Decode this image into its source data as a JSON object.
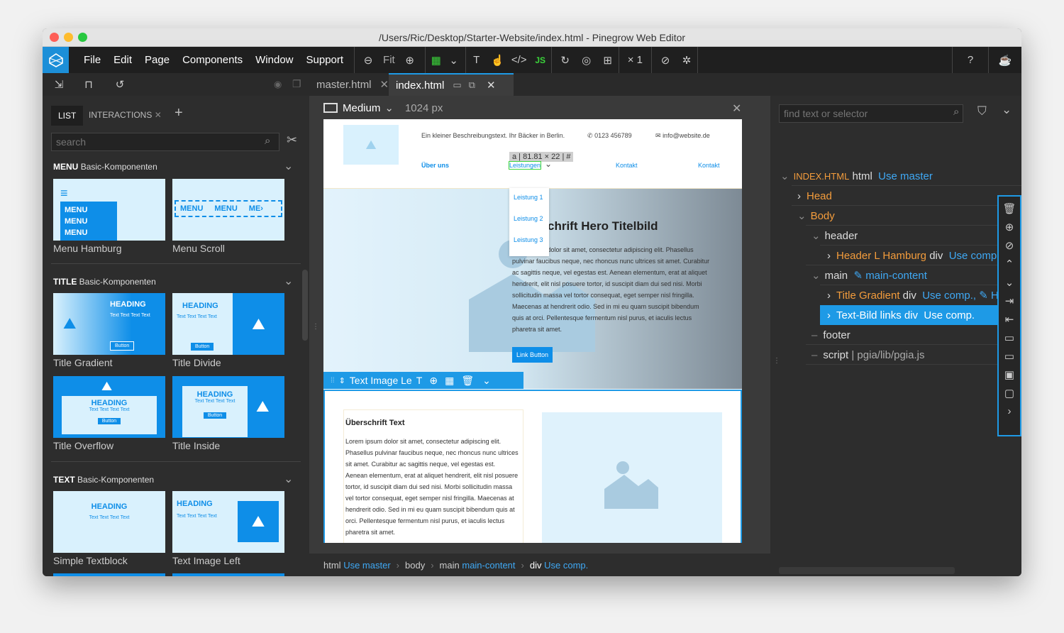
{
  "window": {
    "title": "/Users/Ric/Desktop/Starter-Website/index.html - Pinegrow Web Editor"
  },
  "menu": {
    "file": "File",
    "edit": "Edit",
    "page": "Page",
    "components": "Components",
    "window": "Window",
    "support": "Support"
  },
  "toolbar": {
    "fit": "Fit",
    "zoom": "× 1"
  },
  "tabs": [
    {
      "label": "master.html"
    },
    {
      "label": "index.html"
    }
  ],
  "library": {
    "tab_list": "LIST",
    "tab_interactions": "INTERACTIONS",
    "search_placeholder": "search",
    "sections": [
      {
        "kind": "MENU",
        "name": "Basic-Komponenten"
      },
      {
        "kind": "TITLE",
        "name": "Basic-Komponenten"
      },
      {
        "kind": "TEXT",
        "name": "Basic-Komponenten"
      }
    ],
    "items": [
      "Menu Hamburg",
      "Menu Scroll",
      "Title Gradient",
      "Title Divide",
      "Title Overflow",
      "Title Inside",
      "Simple Textblock",
      "Text Image Left"
    ],
    "thumb_text": {
      "menu": "MENU",
      "heading": "HEADING",
      "button": "Button",
      "text": "Text Text Text Text"
    }
  },
  "canvas": {
    "device": "Medium",
    "width": "1024 px",
    "header_desc": "Ein kleiner Beschreibungstext. Ihr Bäcker in Berlin.",
    "phone": "0123 456789",
    "email": "info@website.de",
    "size_tip": "a | 81.81 × 22 | #",
    "nav": [
      "Über uns",
      "Leistungen",
      "Kontakt",
      "Kontakt"
    ],
    "dropdown": [
      "Leistung 1",
      "Leistung 2",
      "Leistung 3"
    ],
    "hero_title": "chrift Hero Titelbild",
    "hero_text": "orem ipsum dolor sit amet, consectetur adipiscing elit. Phasellus pulvinar faucibus neque, nec rhoncus nunc ultrices sit amet. Curabitur ac sagittis neque, vel egestas est. Aenean elementum, erat at aliquet hendrerit, elit nisl posuere tortor, id suscipit diam dui sed nisi. Morbi sollicitudin massa vel tortor consequat, eget semper nisl fringilla. Maecenas at hendrerit odio. Sed in mi eu quam suscipit bibendum quis at orci. Pellentesque fermentum nisl purus, et iaculis lectus pharetra sit amet.",
    "hero_button": "Link Button",
    "selection_label": "Text Image Le",
    "section_title": "Überschrift Text",
    "section_text": "Lorem ipsum dolor sit amet, consectetur adipiscing elit. Phasellus pulvinar faucibus neque, nec rhoncus nunc ultrices sit amet. Curabitur ac sagittis neque, vel egestas est. Aenean elementum, erat at aliquet hendrerit, elit nisl posuere tortor, id suscipit diam dui sed nisi. Morbi sollicitudin massa vel tortor consequat, eget semper nisl fringilla. Maecenas at hendrerit odio. Sed in mi eu quam suscipit bibendum quis at orci. Pellentesque fermentum nisl purus, et iaculis lectus pharetra sit amet."
  },
  "tree": {
    "search_placeholder": "find text or selector",
    "root": "INDEX.HTML",
    "root_tag": "html",
    "use_master": "Use master",
    "head": "Head",
    "body": "Body",
    "header": "header",
    "header_comp": "Header L Hamburg",
    "div": "div",
    "use_comp": "Use comp.",
    "use_comp2": "Use comp.,",
    "main": "main",
    "main_content": "main-content",
    "title_gradient": "Title Gradient",
    "text_bild": "Text-Bild links",
    "footer": "footer",
    "script": "script",
    "script_src": "| pgia/lib/pgia.js"
  },
  "breadcrumb": {
    "html": "html",
    "use_master": "Use master",
    "body": "body",
    "main": "main",
    "main_content": "main-content",
    "div": "div",
    "use_comp": "Use comp."
  }
}
